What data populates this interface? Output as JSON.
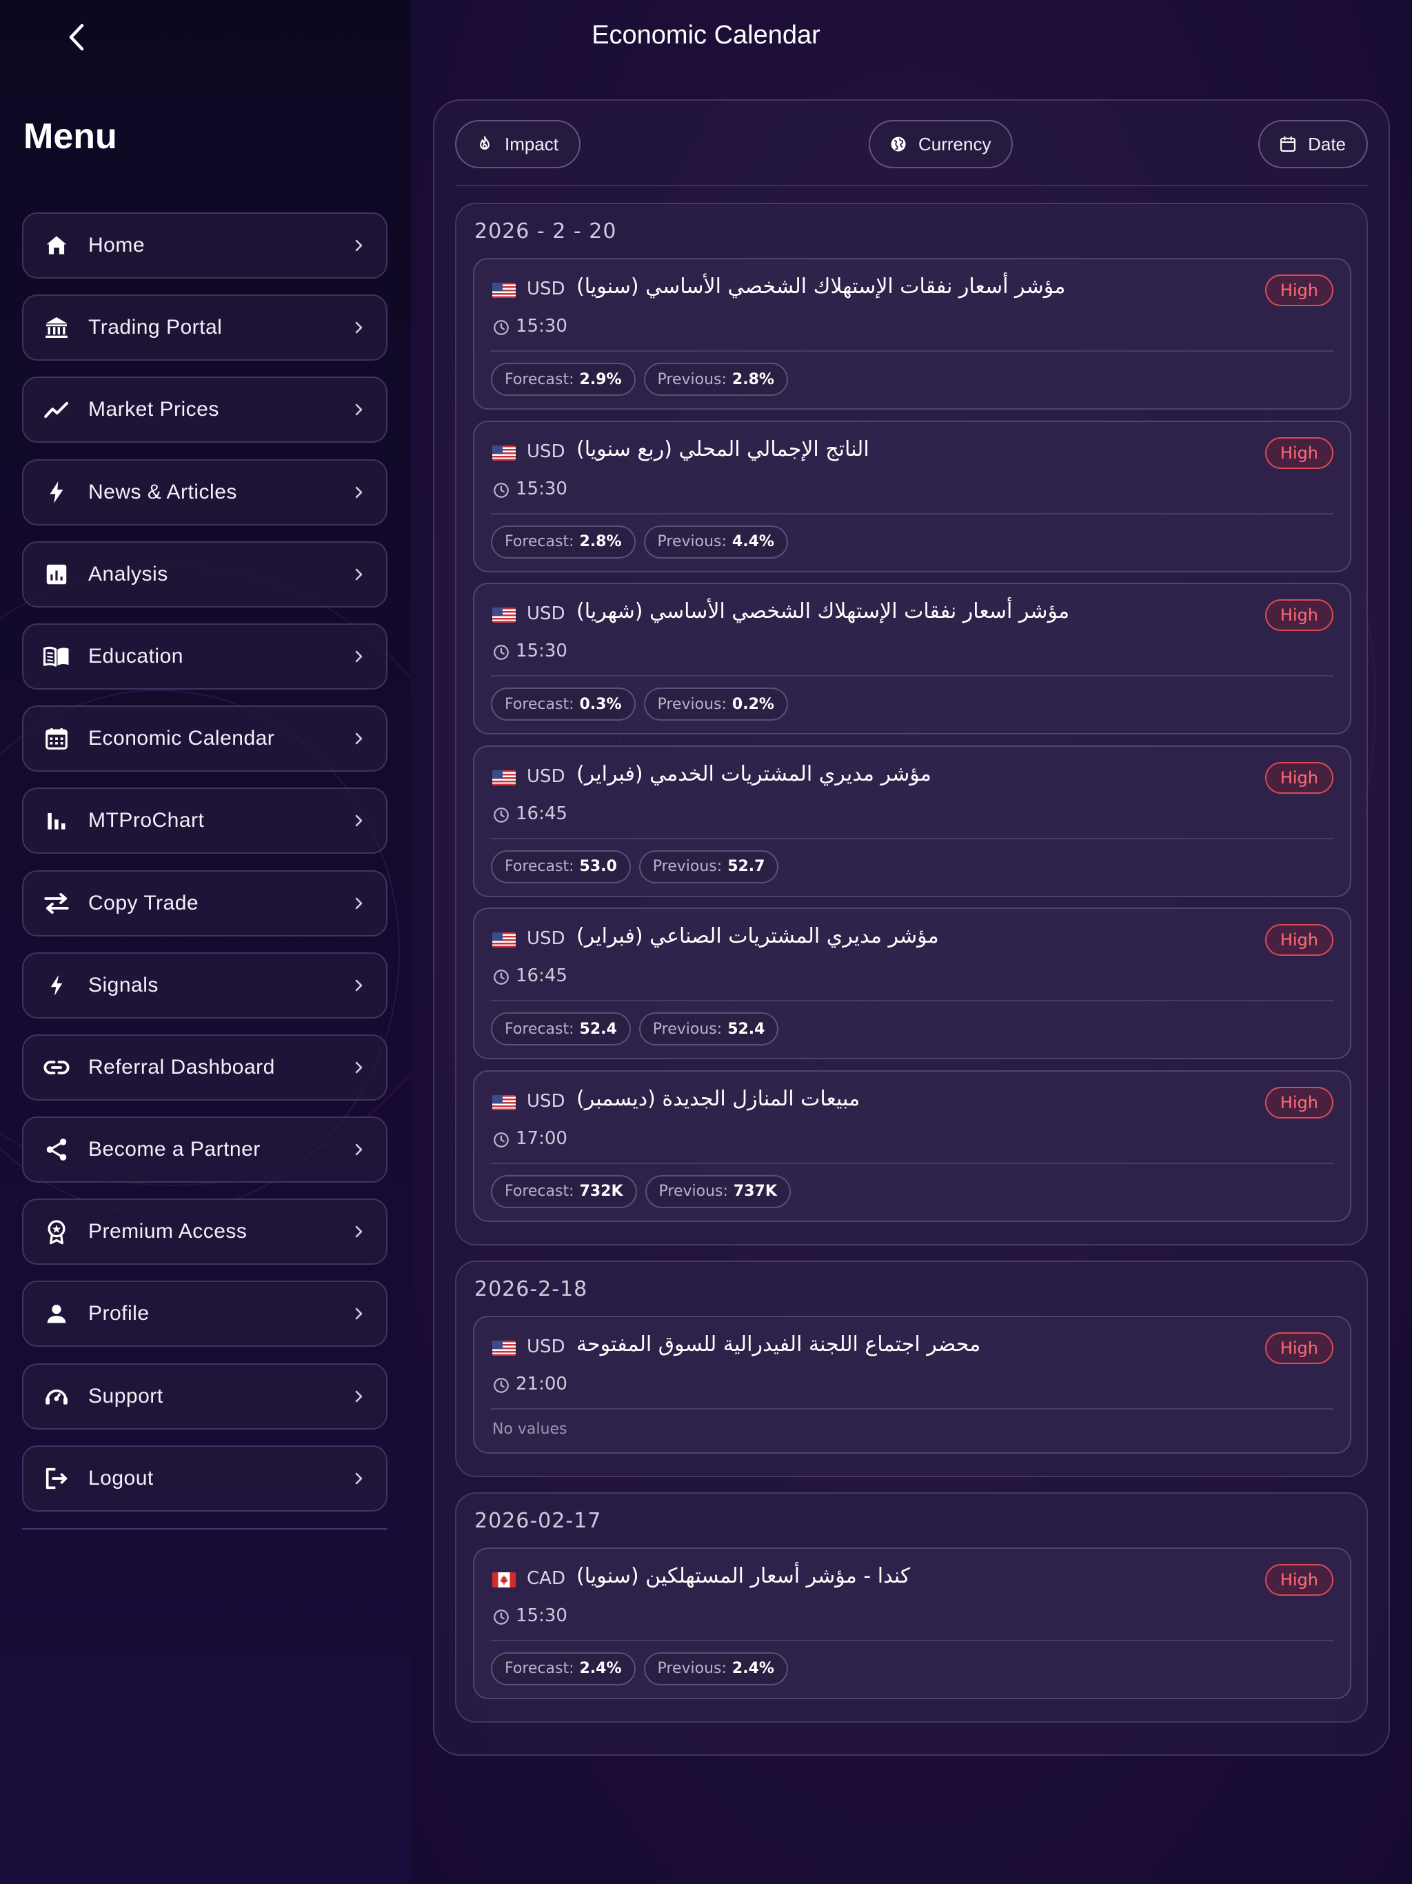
{
  "header": {
    "title": "Economic Calendar"
  },
  "sidebar": {
    "title": "Menu",
    "items": [
      {
        "label": "Home",
        "icon": "home-icon"
      },
      {
        "label": "Trading Portal",
        "icon": "bank-icon"
      },
      {
        "label": "Market Prices",
        "icon": "trending-up-icon"
      },
      {
        "label": "News & Articles",
        "icon": "bolt-icon"
      },
      {
        "label": "Analysis",
        "icon": "analytics-icon"
      },
      {
        "label": "Education",
        "icon": "book-icon"
      },
      {
        "label": "Economic Calendar",
        "icon": "calendar-icon"
      },
      {
        "label": "MTProChart",
        "icon": "bar-chart-icon"
      },
      {
        "label": "Copy Trade",
        "icon": "swap-icon"
      },
      {
        "label": "Signals",
        "icon": "flash-icon"
      },
      {
        "label": "Referral Dashboard",
        "icon": "link-icon"
      },
      {
        "label": "Become a Partner",
        "icon": "share-icon"
      },
      {
        "label": "Premium Access",
        "icon": "award-icon"
      },
      {
        "label": "Profile",
        "icon": "person-icon"
      },
      {
        "label": "Support",
        "icon": "support-icon"
      },
      {
        "label": "Logout",
        "icon": "logout-icon"
      }
    ]
  },
  "filters": {
    "impact": "Impact",
    "currency": "Currency",
    "date": "Date"
  },
  "labels": {
    "forecast": "Forecast:",
    "previous": "Previous:",
    "no_values": "No values"
  },
  "colors": {
    "impact_high": "#ff6b74",
    "background": "#12082a"
  },
  "groups": [
    {
      "date": "2026 - 2 - 20",
      "events": [
        {
          "currency": "USD",
          "flag": "us",
          "title": "مؤشر أسعار نفقات الإستهلاك الشخصي الأساسي (سنويا)",
          "impact": "High",
          "time": "15:30",
          "forecast": "2.9%",
          "previous": "2.8%"
        },
        {
          "currency": "USD",
          "flag": "us",
          "title": "الناتج الإجمالي المحلي (ربع سنويا)",
          "impact": "High",
          "time": "15:30",
          "forecast": "2.8%",
          "previous": "4.4%"
        },
        {
          "currency": "USD",
          "flag": "us",
          "title": "مؤشر أسعار نفقات الإستهلاك الشخصي الأساسي (شهريا)",
          "impact": "High",
          "time": "15:30",
          "forecast": "0.3%",
          "previous": "0.2%"
        },
        {
          "currency": "USD",
          "flag": "us",
          "title": "مؤشر مديري المشتريات الخدمي (فبراير)",
          "impact": "High",
          "time": "16:45",
          "forecast": "53.0",
          "previous": "52.7"
        },
        {
          "currency": "USD",
          "flag": "us",
          "title": "مؤشر مديري المشتريات الصناعي (فبراير)",
          "impact": "High",
          "time": "16:45",
          "forecast": "52.4",
          "previous": "52.4"
        },
        {
          "currency": "USD",
          "flag": "us",
          "title": "مبيعات المنازل الجديدة (ديسمبر)",
          "impact": "High",
          "time": "17:00",
          "forecast": "732K",
          "previous": "737K"
        }
      ]
    },
    {
      "date": "2026-2-18",
      "events": [
        {
          "currency": "USD",
          "flag": "us",
          "title": "محضر اجتماع اللجنة الفيدرالية للسوق المفتوحة",
          "impact": "High",
          "time": "21:00",
          "forecast": null,
          "previous": null
        }
      ]
    },
    {
      "date": "2026-02-17",
      "events": [
        {
          "currency": "CAD",
          "flag": "ca",
          "title": "كندا - مؤشر أسعار المستهلكين (سنويا)",
          "impact": "High",
          "time": "15:30",
          "forecast": "2.4%",
          "previous": "2.4%"
        }
      ]
    }
  ]
}
